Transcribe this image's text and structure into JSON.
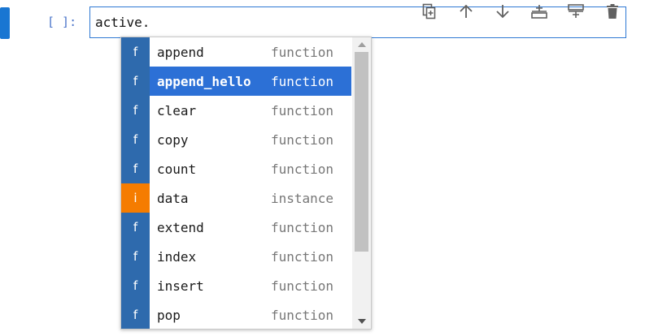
{
  "cell": {
    "prompt": "[ ]:",
    "code": "active."
  },
  "toolbar": {
    "buttons": [
      {
        "icon": "duplicate-icon"
      },
      {
        "icon": "arrow-up-icon"
      },
      {
        "icon": "arrow-down-icon"
      },
      {
        "icon": "insert-above-icon"
      },
      {
        "icon": "insert-below-icon"
      },
      {
        "icon": "trash-icon"
      }
    ]
  },
  "completer": {
    "items": [
      {
        "badge": "f",
        "label": "append",
        "type": "function"
      },
      {
        "badge": "f",
        "label": "append_hello",
        "type": "function"
      },
      {
        "badge": "f",
        "label": "clear",
        "type": "function"
      },
      {
        "badge": "f",
        "label": "copy",
        "type": "function"
      },
      {
        "badge": "f",
        "label": "count",
        "type": "function"
      },
      {
        "badge": "i",
        "label": "data",
        "type": "instance"
      },
      {
        "badge": "f",
        "label": "extend",
        "type": "function"
      },
      {
        "badge": "f",
        "label": "index",
        "type": "function"
      },
      {
        "badge": "f",
        "label": "insert",
        "type": "function"
      },
      {
        "badge": "f",
        "label": "pop",
        "type": "function"
      }
    ],
    "selected_index": 1
  },
  "colors": {
    "accent": "#1976d2",
    "selected_row": "#2c70d6",
    "function_badge": "#2e6aad",
    "instance_badge": "#f57c00"
  }
}
